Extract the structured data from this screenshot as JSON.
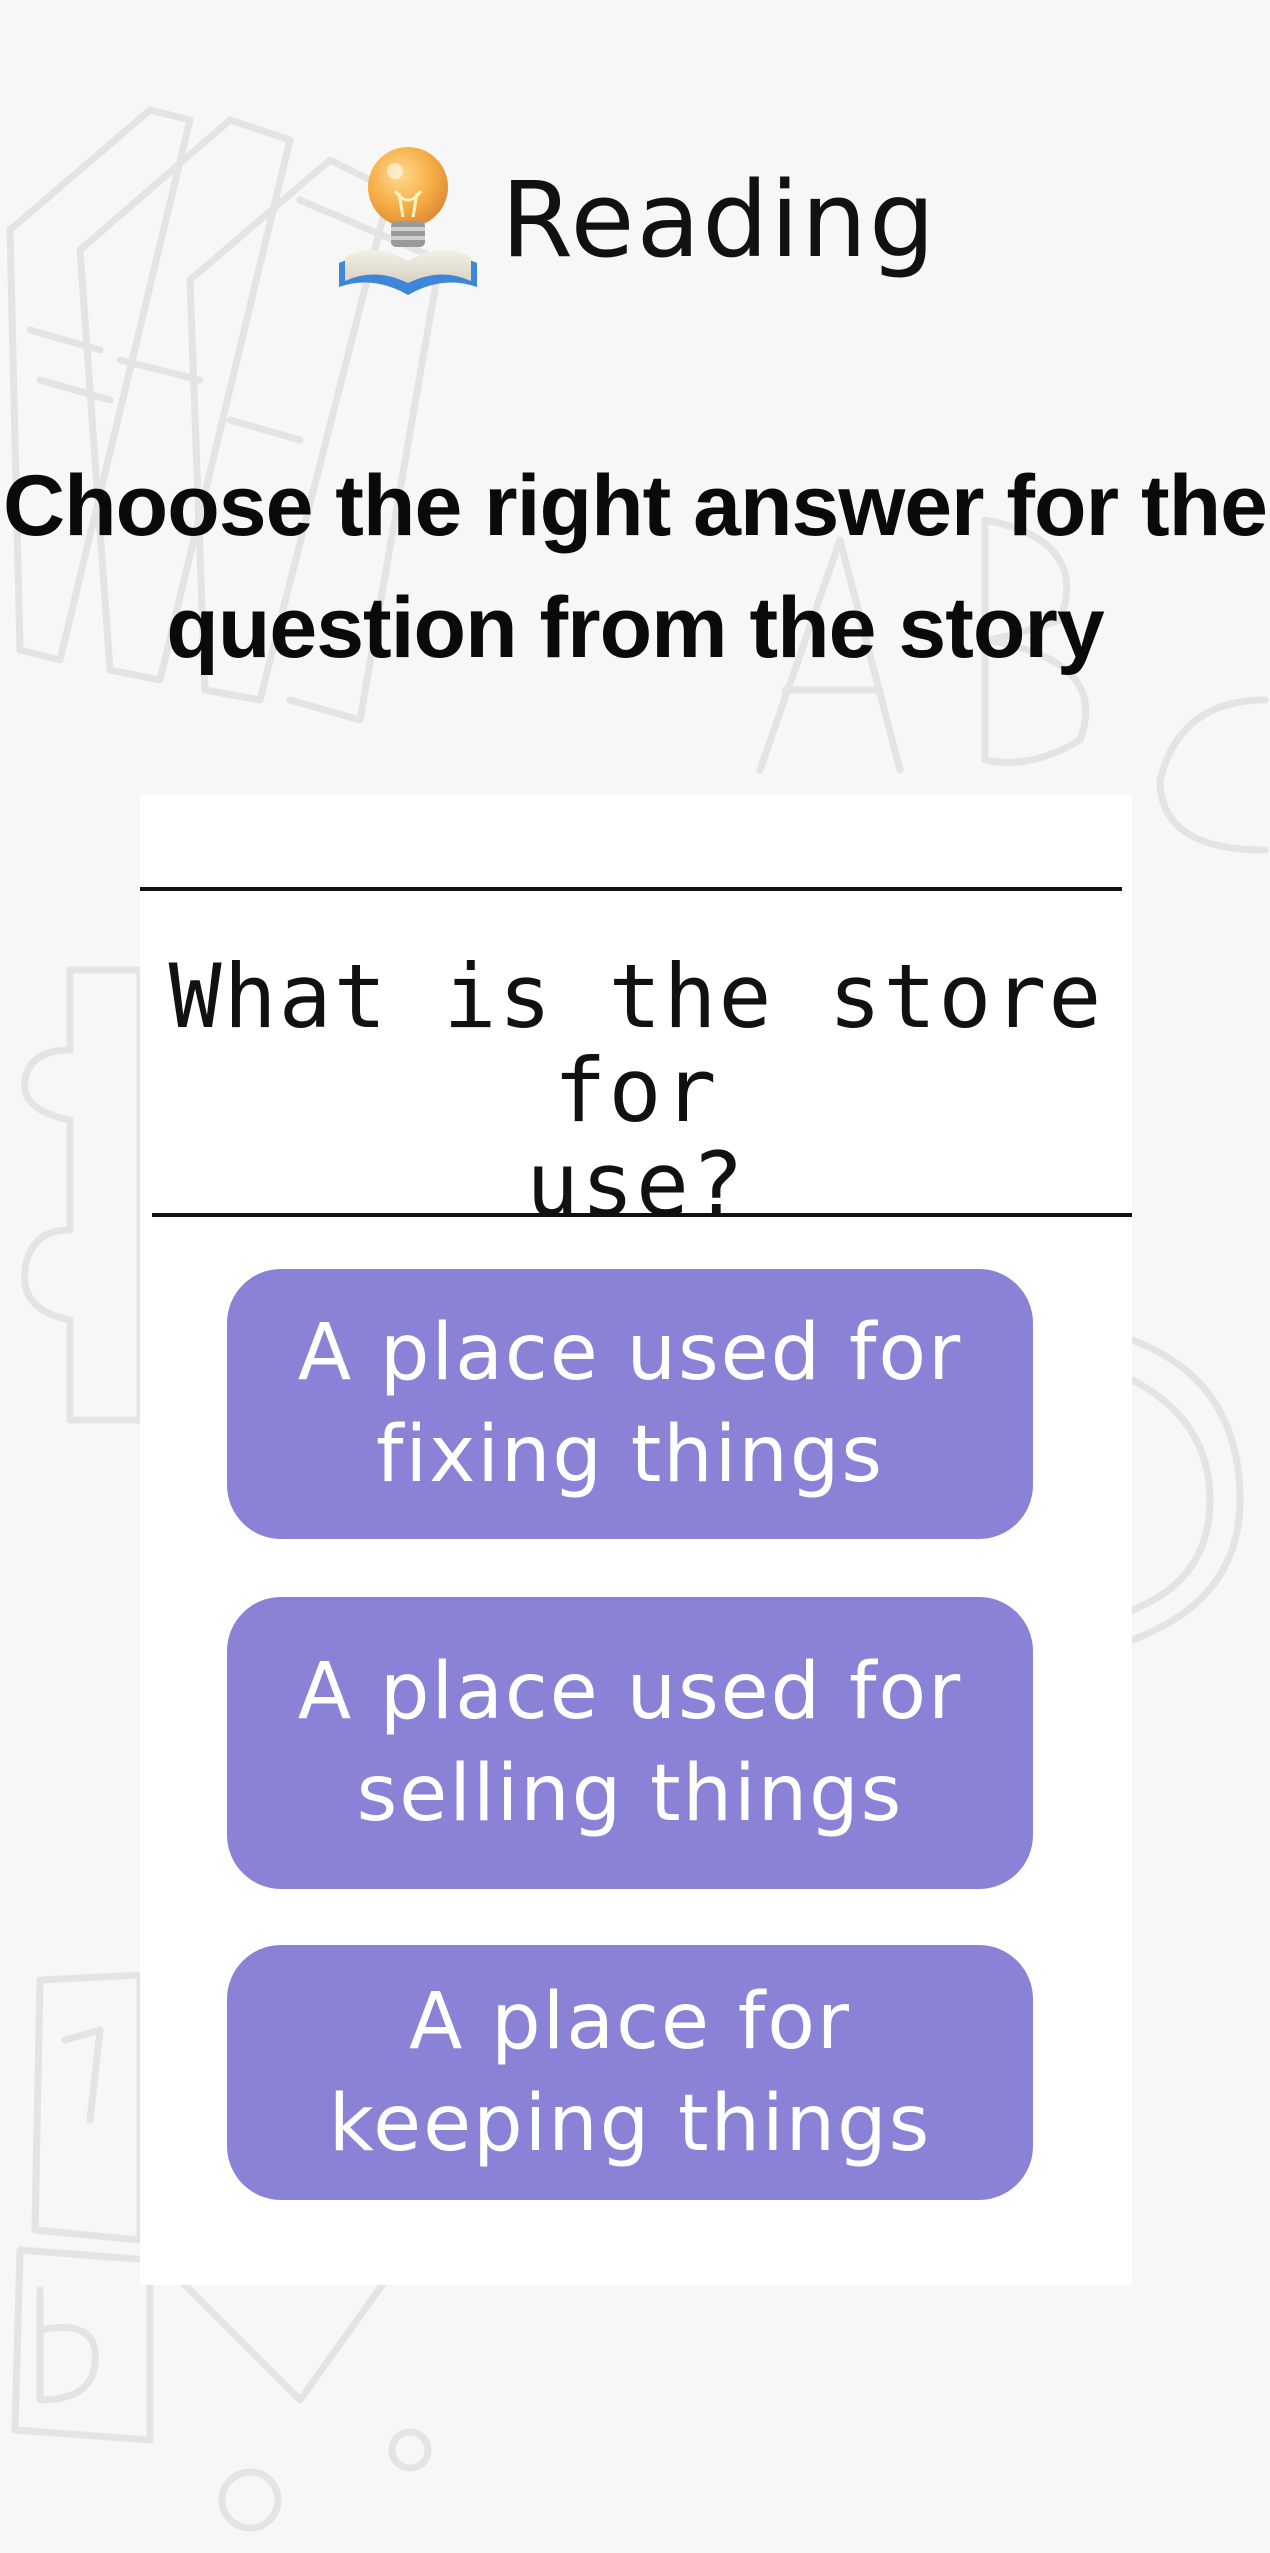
{
  "header": {
    "title": "Reading",
    "icon": "book-lightbulb-icon"
  },
  "instruction": {
    "line1": "Choose the right answer for the",
    "line2": "question from the story"
  },
  "question": {
    "line1": "What is the store for",
    "line2": "use?"
  },
  "answers": [
    {
      "line1": "A place used for",
      "line2": "fixing things"
    },
    {
      "line1": "A place used for",
      "line2": "selling things"
    },
    {
      "line1": "A place for",
      "line2": "keeping things"
    }
  ],
  "colors": {
    "background": "#f7f7f7",
    "card": "#ffffff",
    "answer_button": "#8982d6",
    "answer_text": "#ffffff",
    "text": "#111111"
  }
}
